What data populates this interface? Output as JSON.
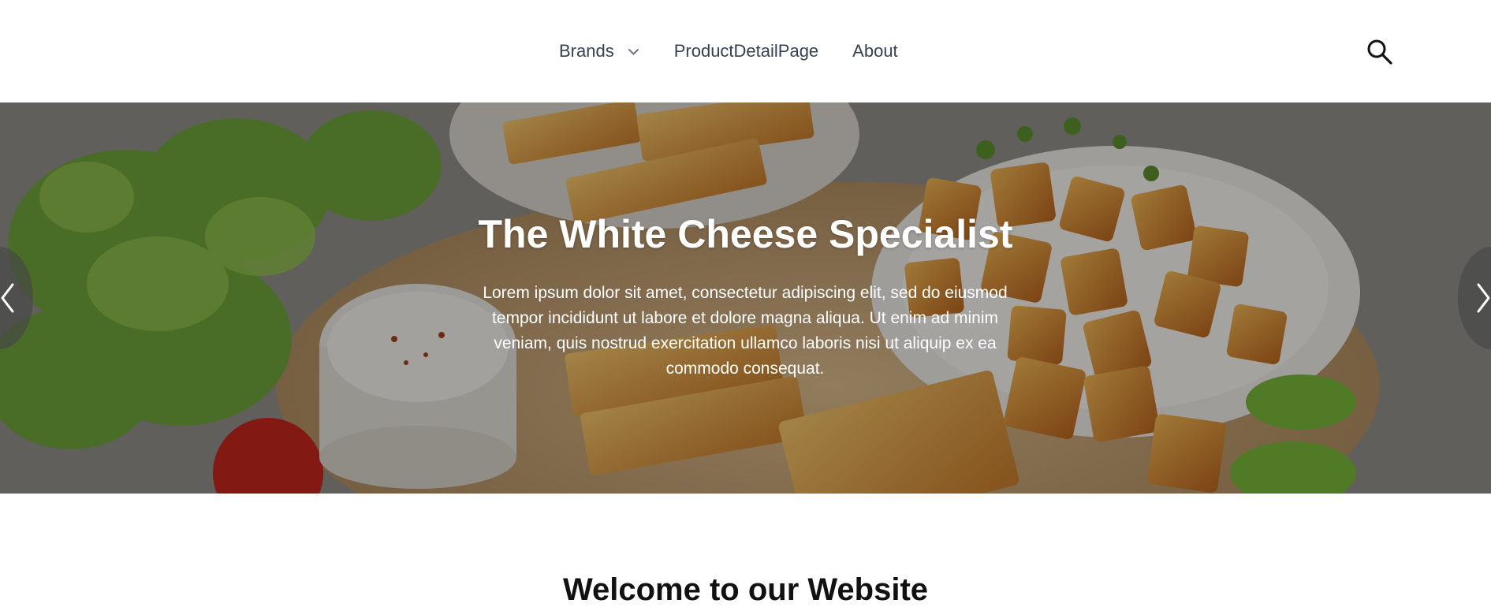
{
  "nav": {
    "items": [
      {
        "label": "Brands",
        "has_dropdown": true
      },
      {
        "label": "ProductDetailPage",
        "has_dropdown": false
      },
      {
        "label": "About",
        "has_dropdown": false
      }
    ],
    "search_icon": "search-icon"
  },
  "hero": {
    "title": "The White Cheese Specialist",
    "text": "Lorem ipsum dolor sit amet, consectetur adipiscing elit, sed do eiusmod tempor incididunt ut labore et dolore magna aliqua. Ut enim ad minim veniam, quis nostrud exercitation ullamco laboris nisi ut aliquip ex ea commodo consequat.",
    "prev_icon": "chevron-left-icon",
    "next_icon": "chevron-right-icon"
  },
  "welcome": {
    "title": "Welcome to our Website"
  },
  "colors": {
    "nav_text": "#374151",
    "hero_overlay": "#000000",
    "heading": "#111111"
  }
}
